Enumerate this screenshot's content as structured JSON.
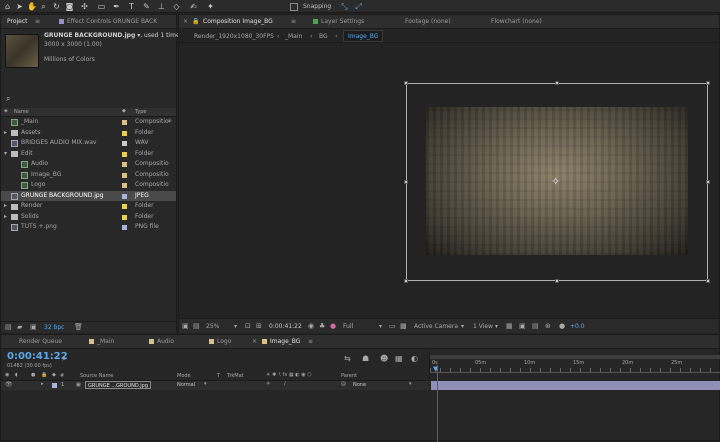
{
  "toolbar": {
    "snapping_label": "Snapping",
    "tools": [
      "home-icon",
      "selection-icon",
      "hand-icon",
      "zoom-icon",
      "rotate-icon",
      "camera-icon",
      "pan-behind-icon",
      "rectangle-mask-icon",
      "pen-icon",
      "type-icon",
      "brush-icon",
      "clone-stamp-icon",
      "eraser-icon",
      "roto-brush-icon",
      "puppet-pin-icon"
    ]
  },
  "project_panel": {
    "tab_label": "Project",
    "effect_controls_tab": "Effect Controls GRUNGE BACK",
    "preview": {
      "filename": "GRUNGE BACKGROUND.jpg",
      "used": ", used 1 time",
      "dimensions": "3000 x 3000 (1.00)",
      "colors": "Millions of Colors"
    },
    "col_name": "Name",
    "col_type": "Type",
    "bpc_label": "32 bpc",
    "items": [
      {
        "name": "_Main",
        "type": "Compositio",
        "icon": "composition-icon",
        "indent": 0,
        "label_color": "#d8c08a"
      },
      {
        "name": "Assets",
        "type": "Folder",
        "icon": "folder-icon",
        "indent": 0,
        "label_color": "#e6d05a"
      },
      {
        "name": "BRIDGES AUDIO MIX.wav",
        "type": "WAV",
        "icon": "audio-file-icon",
        "indent": 0,
        "label_color": "#c9c9c9"
      },
      {
        "name": "Edit",
        "type": "Folder",
        "icon": "folder-icon",
        "indent": 0,
        "label_color": "#e6d05a"
      },
      {
        "name": "Audio",
        "type": "Compositio",
        "icon": "composition-icon",
        "indent": 1,
        "label_color": "#d8c08a"
      },
      {
        "name": "Image_BG",
        "type": "Compositio",
        "icon": "composition-icon",
        "indent": 1,
        "label_color": "#d8c08a"
      },
      {
        "name": "Logo",
        "type": "Compositio",
        "icon": "composition-icon",
        "indent": 1,
        "label_color": "#d8c08a"
      },
      {
        "name": "GRUNGE BACKGROUND.jpg",
        "type": "JPEG",
        "icon": "image-file-icon",
        "indent": 0,
        "label_color": "#a9b4d8"
      },
      {
        "name": "Render",
        "type": "Folder",
        "icon": "folder-icon",
        "indent": 0,
        "label_color": "#e6d05a"
      },
      {
        "name": "Solids",
        "type": "Folder",
        "icon": "folder-icon",
        "indent": 0,
        "label_color": "#e6d05a"
      },
      {
        "name": "TUTS +.png",
        "type": "PNG file",
        "icon": "image-file-icon",
        "indent": 0,
        "label_color": "#a9b4d8"
      }
    ]
  },
  "comp_panel": {
    "tabs": [
      "Composition Image_BG",
      "Layer Settings",
      "Footage (none)",
      "Flowchart (none)"
    ],
    "breadcrumbs": [
      "Render_1920x1080_30FPS",
      "_Main",
      "BG",
      "Image_BG"
    ],
    "zoom": "25%",
    "timecode": "0:00:41:22",
    "resolution": "Full",
    "camera": "Active Camera",
    "view": "1 View",
    "exposure": "+0.0"
  },
  "timeline": {
    "tabs": [
      "Render Queue",
      "_Main",
      "Audio",
      "Logo",
      "Image_BG"
    ],
    "timecode": "0:00:41:22",
    "frames": "01482 (30.00 fps)",
    "col_source": "Source Name",
    "col_mode": "Mode",
    "col_t": "T",
    "col_trkmat": "TrkMat",
    "col_parent": "Parent",
    "layer": {
      "num": "1",
      "name": "GRUNGE ...GROUND.jpg",
      "mode": "Normal",
      "parent": "None"
    },
    "ruler": [
      "0s",
      "05m",
      "10m",
      "15m",
      "20m",
      "25m"
    ]
  },
  "colors": {
    "accent": "#5aa8e8",
    "playhead": "#d03030",
    "layer_bar": "#8f8fb8"
  }
}
